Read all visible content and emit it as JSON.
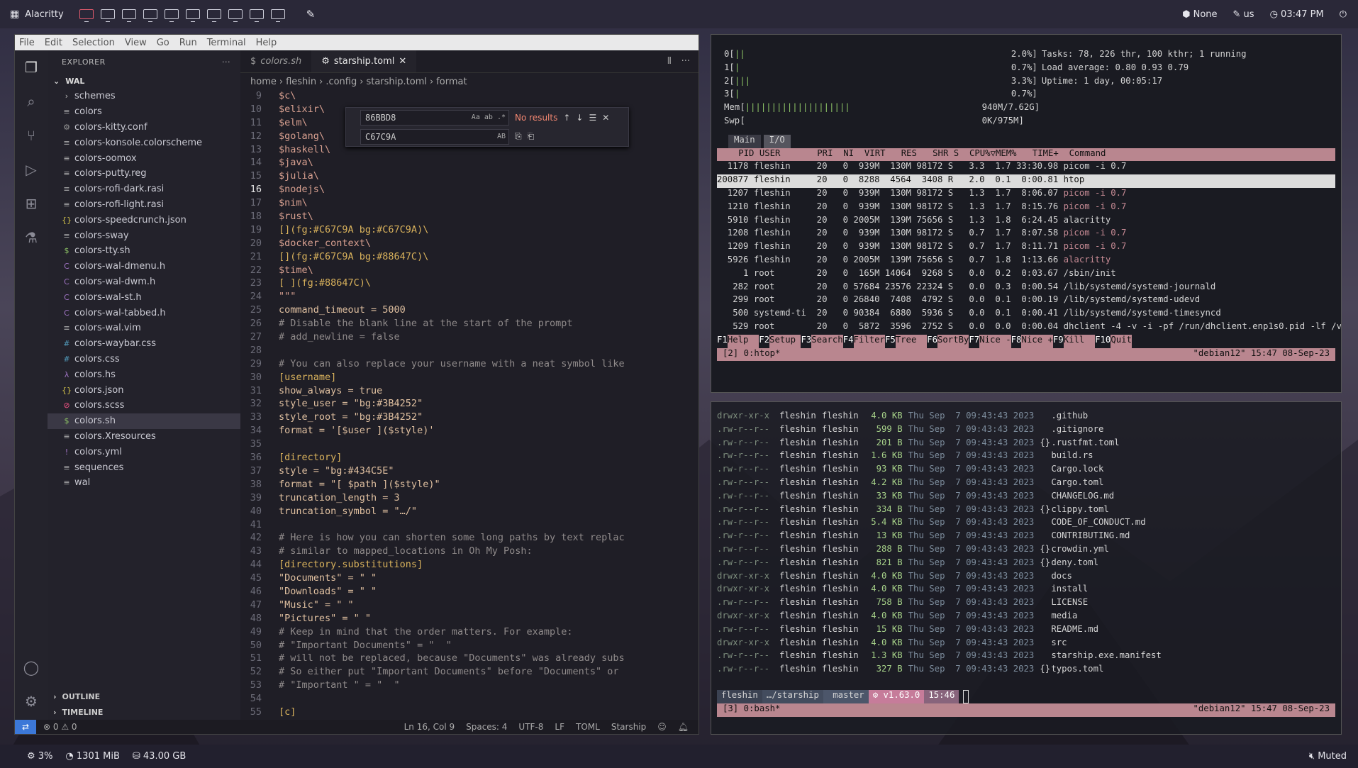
{
  "topbar": {
    "app_name": "Alacritty",
    "workspaces": 10,
    "active_workspace": 0,
    "right": {
      "layout": "None",
      "keyboard": "us",
      "clock": "03:47 PM"
    }
  },
  "bottombar": {
    "cpu": "3%",
    "mem": "1301 MiB",
    "disk": "43.00 GB",
    "volume": "Muted"
  },
  "vscode": {
    "menu": [
      "File",
      "Edit",
      "Selection",
      "View",
      "Go",
      "Run",
      "Terminal",
      "Help"
    ],
    "explorer": {
      "title": "EXPLORER",
      "more": "···",
      "folder": "WAL",
      "items": [
        {
          "icon": "›",
          "name": "schemes",
          "color": "#bbbbbb"
        },
        {
          "icon": "≡",
          "name": "colors",
          "color": "#aaaaaa"
        },
        {
          "icon": "⚙",
          "name": "colors-kitty.conf",
          "color": "#999999"
        },
        {
          "icon": "≡",
          "name": "colors-konsole.colorscheme",
          "color": "#aaaaaa"
        },
        {
          "icon": "≡",
          "name": "colors-oomox",
          "color": "#aaaaaa"
        },
        {
          "icon": "≡",
          "name": "colors-putty.reg",
          "color": "#aaaaaa"
        },
        {
          "icon": "≡",
          "name": "colors-rofi-dark.rasi",
          "color": "#aaaaaa"
        },
        {
          "icon": "≡",
          "name": "colors-rofi-light.rasi",
          "color": "#aaaaaa"
        },
        {
          "icon": "{}",
          "name": "colors-speedcrunch.json",
          "color": "#d4c44a"
        },
        {
          "icon": "≡",
          "name": "colors-sway",
          "color": "#aaaaaa"
        },
        {
          "icon": "$",
          "name": "colors-tty.sh",
          "color": "#8cc265"
        },
        {
          "icon": "C",
          "name": "colors-wal-dmenu.h",
          "color": "#a074c4"
        },
        {
          "icon": "C",
          "name": "colors-wal-dwm.h",
          "color": "#a074c4"
        },
        {
          "icon": "C",
          "name": "colors-wal-st.h",
          "color": "#a074c4"
        },
        {
          "icon": "C",
          "name": "colors-wal-tabbed.h",
          "color": "#a074c4"
        },
        {
          "icon": "≡",
          "name": "colors-wal.vim",
          "color": "#aaaaaa"
        },
        {
          "icon": "#",
          "name": "colors-waybar.css",
          "color": "#519aba"
        },
        {
          "icon": "#",
          "name": "colors.css",
          "color": "#519aba"
        },
        {
          "icon": "λ",
          "name": "colors.hs",
          "color": "#a074c4"
        },
        {
          "icon": "{}",
          "name": "colors.json",
          "color": "#d4c44a"
        },
        {
          "icon": "⊘",
          "name": "colors.scss",
          "color": "#f55385"
        },
        {
          "icon": "$",
          "name": "colors.sh",
          "color": "#8cc265"
        },
        {
          "icon": "≡",
          "name": "colors.Xresources",
          "color": "#aaaaaa"
        },
        {
          "icon": "!",
          "name": "colors.yml",
          "color": "#a074c4"
        },
        {
          "icon": "≡",
          "name": "sequences",
          "color": "#aaaaaa"
        },
        {
          "icon": "≡",
          "name": "wal",
          "color": "#aaaaaa"
        }
      ],
      "selected": 21,
      "outline": "OUTLINE",
      "timeline": "TIMELINE"
    },
    "tabs": [
      {
        "name": "colors.sh",
        "italic": true,
        "active": false
      },
      {
        "name": "starship.toml",
        "italic": false,
        "active": true
      }
    ],
    "breadcrumb": [
      "home",
      "fleshin",
      ".config",
      "starship.toml",
      "format"
    ],
    "find": {
      "query": "86BBD8",
      "result": "No results",
      "replace": "C67C9A",
      "opt_aa": "Aa",
      "opt_ab": "ab",
      "opt_re": ".*",
      "opt_ab2": "AB"
    },
    "code_start": 9,
    "current_line": 16,
    "code": [
      "$c\\",
      "$elixir\\",
      "$elm\\",
      "$golang\\",
      "$haskell\\",
      "$java\\",
      "$julia\\",
      "$nodejs\\",
      "$nim\\",
      "$rust\\",
      "[](fg:#C67C9A bg:#C67C9A)\\",
      "$docker_context\\",
      "[](fg:#C67C9A bg:#88647C)\\",
      "$time\\",
      "[ ](fg:#88647C)\\",
      "\"\"\"",
      "command_timeout = 5000",
      "# Disable the blank line at the start of the prompt",
      "# add_newline = false",
      "",
      "# You can also replace your username with a neat symbol like",
      "[username]",
      "show_always = true",
      "style_user = \"bg:#3B4252\"",
      "style_root = \"bg:#3B4252\"",
      "format = '[$user ]($style)'",
      "",
      "[directory]",
      "style = \"bg:#434C5E\"",
      "format = \"[ $path ]($style)\"",
      "truncation_length = 3",
      "truncation_symbol = \"…/\"",
      "",
      "# Here is how you can shorten some long paths by text replac",
      "# similar to mapped_locations in Oh My Posh:",
      "[directory.substitutions]",
      "\"Documents\" = \" \"",
      "\"Downloads\" = \" \"",
      "\"Music\" = \" \"",
      "\"Pictures\" = \" \"",
      "# Keep in mind that the order matters. For example:",
      "# \"Important Documents\" = \"  \"",
      "# will not be replaced, because \"Documents\" was already subs",
      "# So either put \"Important Documents\" before \"Documents\" or",
      "# \"Important \" = \"  \"",
      "",
      "[c]"
    ],
    "status": {
      "errors": "0",
      "warnings": "0",
      "pos": "Ln 16, Col 9",
      "spaces": "Spaces: 4",
      "enc": "UTF-8",
      "eol": "LF",
      "lang": "TOML",
      "ext": "Starship"
    }
  },
  "htop": {
    "cpus": [
      {
        "id": "0",
        "bar": "||",
        "pct": "2.0%]"
      },
      {
        "id": "1",
        "bar": "|",
        "pct": "0.7%]"
      },
      {
        "id": "2",
        "bar": "|||",
        "pct": "3.3%]"
      },
      {
        "id": "3",
        "bar": "|",
        "pct": "0.7%]"
      }
    ],
    "mem": {
      "bar": "||||||||||||||||||||",
      "val": "940M/7.62G]"
    },
    "swp": {
      "bar": "",
      "val": "0K/975M]"
    },
    "tasks": "Tasks: 78, 226 thr, 100 kthr; 1 running",
    "load": "Load average: 0.80 0.93 0.79",
    "uptime": "Uptime: 1 day, 00:05:17",
    "tabs": [
      "Main",
      "I/O"
    ],
    "header": "   PID USER       PRI  NI  VIRT   RES   SHR S  CPU%▽MEM%   TIME+  Command",
    "rows": [
      {
        "t": "  1178 fleshin     20   0  939M  130M 98172 S   3.3  1.7 33:30.98 ",
        "c": "picom -i 0.7",
        "m": false
      },
      {
        "t": "200877 fleshin     20   0  8288  4564  3408 R   2.0  0.1  0:00.81 ",
        "c": "htop",
        "m": false,
        "sel": true
      },
      {
        "t": "  1207 fleshin     20   0  939M  130M 98172 S   1.3  1.7  8:06.07 ",
        "c": "picom -i 0.7",
        "m": true
      },
      {
        "t": "  1210 fleshin     20   0  939M  130M 98172 S   1.3  1.7  8:15.76 ",
        "c": "picom -i 0.7",
        "m": true
      },
      {
        "t": "  5910 fleshin     20   0 2005M  139M 75656 S   1.3  1.8  6:24.45 ",
        "c": "alacritty",
        "m": false
      },
      {
        "t": "  1208 fleshin     20   0  939M  130M 98172 S   0.7  1.7  8:07.58 ",
        "c": "picom -i 0.7",
        "m": true
      },
      {
        "t": "  1209 fleshin     20   0  939M  130M 98172 S   0.7  1.7  8:11.71 ",
        "c": "picom -i 0.7",
        "m": true
      },
      {
        "t": "  5926 fleshin     20   0 2005M  139M 75656 S   0.7  1.8  1:13.66 ",
        "c": "alacritty",
        "m": true
      },
      {
        "t": "     1 root        20   0  165M 14064  9268 S   0.0  0.2  0:03.67 ",
        "c": "/sbin/init",
        "m": false
      },
      {
        "t": "   282 root        20   0 57684 23576 22324 S   0.0  0.3  0:00.54 ",
        "c": "/lib/systemd/systemd-journald",
        "m": false
      },
      {
        "t": "   299 root        20   0 26840  7408  4792 S   0.0  0.1  0:00.19 ",
        "c": "/lib/systemd/systemd-udevd",
        "m": false
      },
      {
        "t": "   500 systemd-ti  20   0 90384  6880  5936 S   0.0  0.1  0:00.41 ",
        "c": "/lib/systemd/systemd-timesyncd",
        "m": false
      },
      {
        "t": "   529 root        20   0  5872  3596  2752 S   0.0  0.0  0:00.04 ",
        "c": "dhclient -4 -v -i -pf /run/dhclient.enp1s0.pid -lf /var/lib",
        "m": false
      }
    ],
    "fkeys": [
      [
        "F1",
        "Help  "
      ],
      [
        "F2",
        "Setup "
      ],
      [
        "F3",
        "Search"
      ],
      [
        "F4",
        "Filter"
      ],
      [
        "F5",
        "Tree  "
      ],
      [
        "F6",
        "SortBy"
      ],
      [
        "F7",
        "Nice -"
      ],
      [
        "F8",
        "Nice +"
      ],
      [
        "F9",
        "Kill  "
      ],
      [
        "F10",
        "Quit"
      ]
    ],
    "tmux_left": "[2] 0:htop*",
    "tmux_right": "\"debian12\" 15:47 08-Sep-23"
  },
  "ls": {
    "rows": [
      {
        "p": "drwxr-xr-x",
        "s": "4.0 KB",
        "i": "",
        "n": ".github"
      },
      {
        "p": ".rw-r--r--",
        "s": "599 B",
        "i": "",
        "n": ".gitignore"
      },
      {
        "p": ".rw-r--r--",
        "s": "201 B",
        "i": "{}",
        "n": ".rustfmt.toml"
      },
      {
        "p": ".rw-r--r--",
        "s": "1.6 KB",
        "i": "",
        "n": "build.rs"
      },
      {
        "p": ".rw-r--r--",
        "s": "93 KB",
        "i": "",
        "n": "Cargo.lock"
      },
      {
        "p": ".rw-r--r--",
        "s": "4.2 KB",
        "i": "",
        "n": "Cargo.toml"
      },
      {
        "p": ".rw-r--r--",
        "s": "33 KB",
        "i": "",
        "n": "CHANGELOG.md"
      },
      {
        "p": ".rw-r--r--",
        "s": "334 B",
        "i": "{}",
        "n": "clippy.toml"
      },
      {
        "p": ".rw-r--r--",
        "s": "5.4 KB",
        "i": "",
        "n": "CODE_OF_CONDUCT.md"
      },
      {
        "p": ".rw-r--r--",
        "s": "13 KB",
        "i": "",
        "n": "CONTRIBUTING.md"
      },
      {
        "p": ".rw-r--r--",
        "s": "288 B",
        "i": "{}",
        "n": "crowdin.yml"
      },
      {
        "p": ".rw-r--r--",
        "s": "821 B",
        "i": "{}",
        "n": "deny.toml"
      },
      {
        "p": "drwxr-xr-x",
        "s": "4.0 KB",
        "i": "",
        "n": "docs"
      },
      {
        "p": "drwxr-xr-x",
        "s": "4.0 KB",
        "i": "",
        "n": "install"
      },
      {
        "p": ".rw-r--r--",
        "s": "758 B",
        "i": "",
        "n": "LICENSE"
      },
      {
        "p": "drwxr-xr-x",
        "s": "4.0 KB",
        "i": "",
        "n": "media"
      },
      {
        "p": ".rw-r--r--",
        "s": "15 KB",
        "i": "",
        "n": "README.md"
      },
      {
        "p": "drwxr-xr-x",
        "s": "4.0 KB",
        "i": "",
        "n": "src"
      },
      {
        "p": ".rw-r--r--",
        "s": "1.3 KB",
        "i": "",
        "n": "starship.exe.manifest"
      },
      {
        "p": ".rw-r--r--",
        "s": "327 B",
        "i": "{}",
        "n": "typos.toml"
      }
    ],
    "owner": "fleshin",
    "group": "fleshin",
    "date": "Thu Sep  7 09:43:43 2023",
    "prompt": {
      "user": "fleshin",
      "dir": "…/starship",
      "branch": "master",
      "ver": "v1.63.0",
      "time": "15:46"
    },
    "tmux_left": "[3] 0:bash*",
    "tmux_right": "\"debian12\" 15:47 08-Sep-23"
  }
}
